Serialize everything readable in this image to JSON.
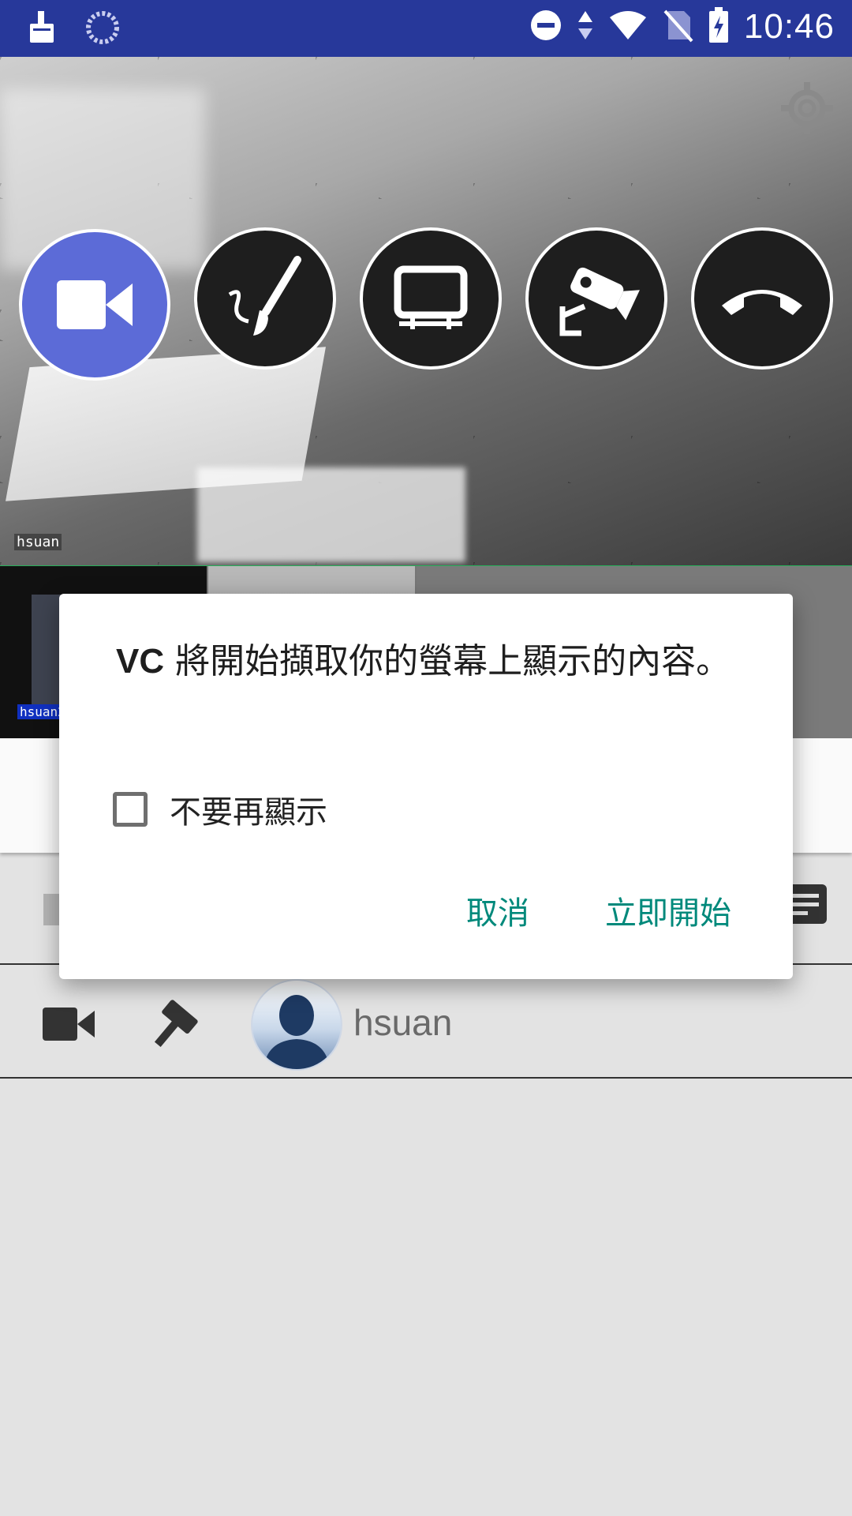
{
  "status_bar": {
    "time": "10:46",
    "icons": [
      "cleaner-icon",
      "sync-icon",
      "do-not-disturb-icon",
      "data-arrows-icon",
      "wifi-icon",
      "no-sim-icon",
      "battery-charging-icon"
    ]
  },
  "video": {
    "participant_name": "hsuan",
    "controls": [
      {
        "name": "camera",
        "icon": "videocam-icon",
        "active": true
      },
      {
        "name": "whiteboard",
        "icon": "brush-icon",
        "active": false
      },
      {
        "name": "screen-share",
        "icon": "monitor-icon",
        "active": false
      },
      {
        "name": "cctv",
        "icon": "security-camera-icon",
        "active": false
      },
      {
        "name": "hang-up",
        "icon": "call-end-icon",
        "active": false
      }
    ]
  },
  "thumbnails": [
    {
      "label": "hsuan2"
    }
  ],
  "user_row": {
    "name": "hsuan"
  },
  "dialog": {
    "title_brand": "VC",
    "title_text": " 將開始擷取你的螢幕上顯示的內容。",
    "checkbox_label": "不要再顯示",
    "checkbox_checked": false,
    "cancel_label": "取消",
    "start_label": "立即開始"
  },
  "colors": {
    "status_bar": "#27389a",
    "active_control": "#5c6bd7",
    "dialog_button": "#00897b",
    "background": "#e3e3e3"
  }
}
